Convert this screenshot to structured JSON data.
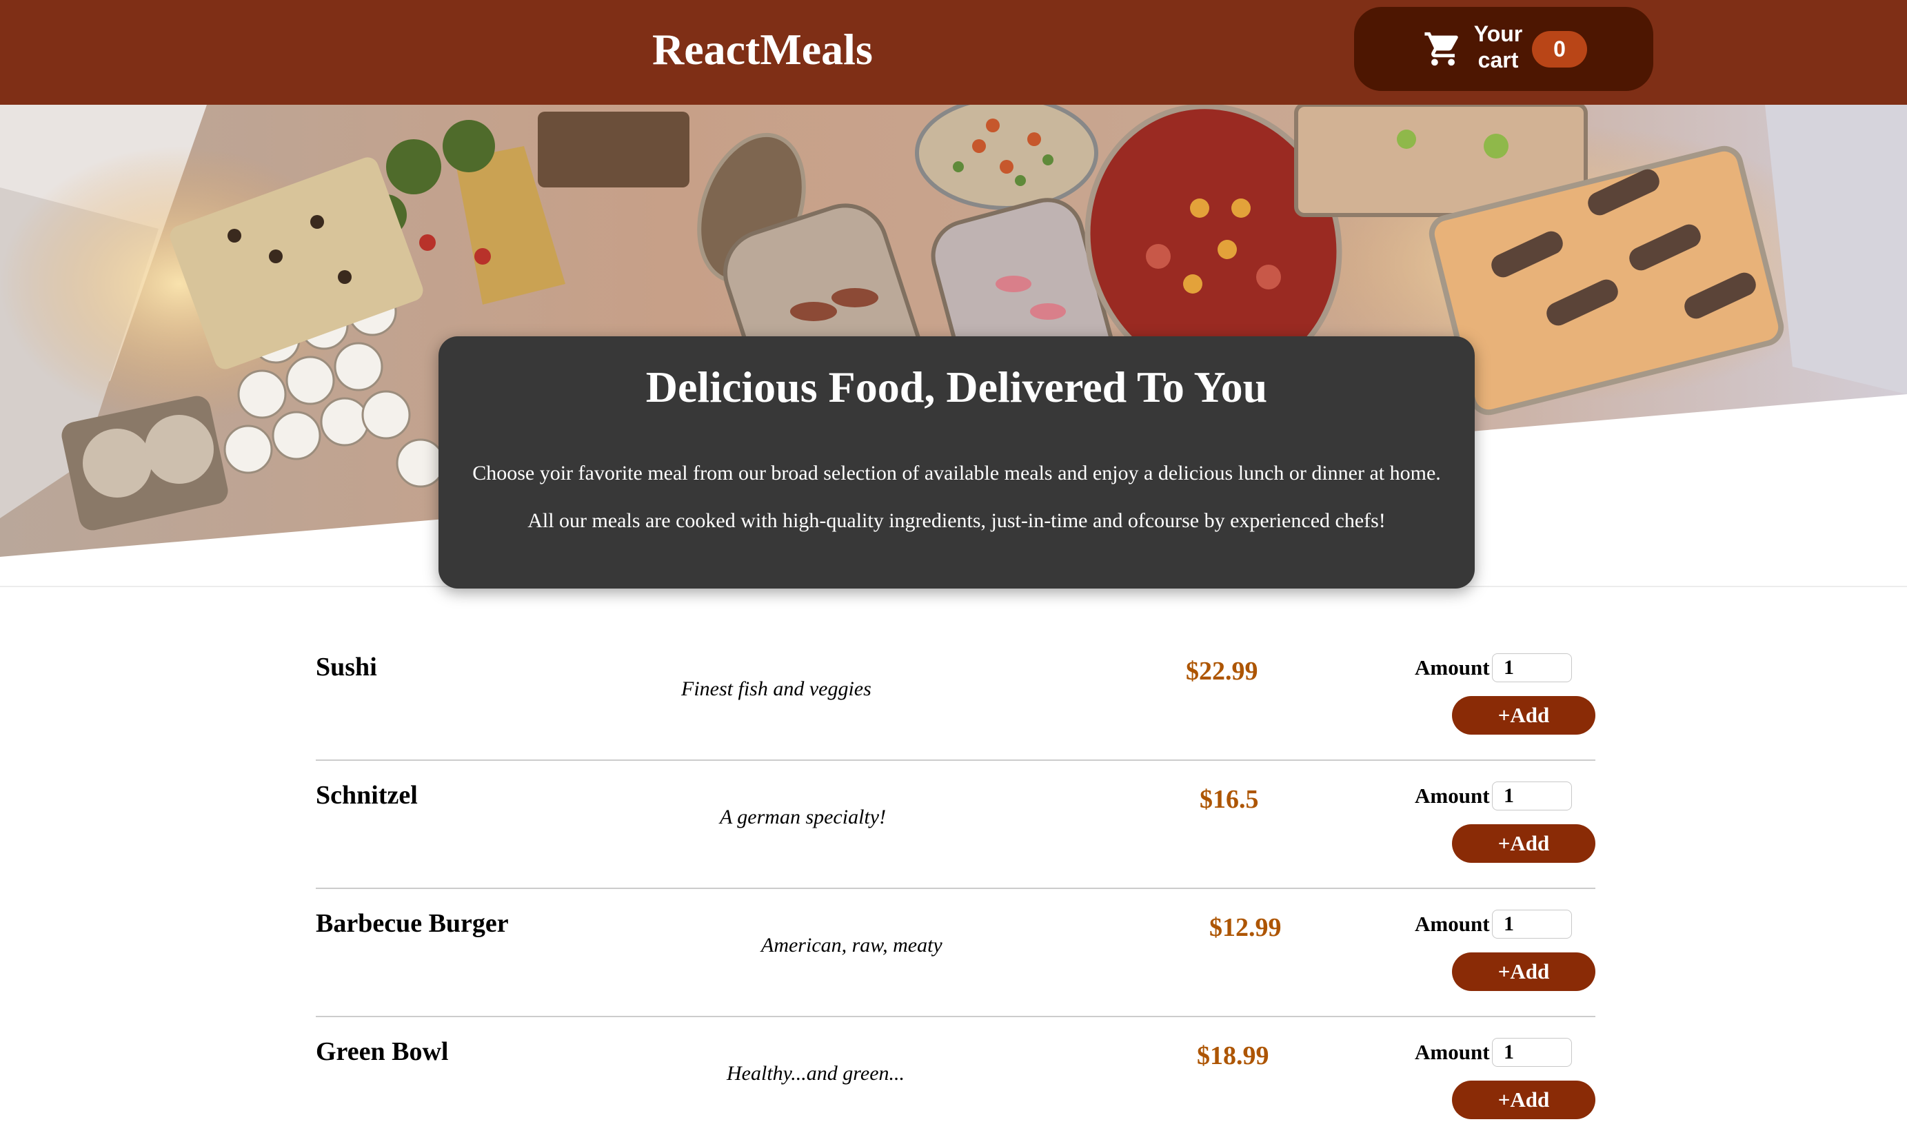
{
  "header": {
    "brand": "ReactMeals",
    "cart_label": "Your cart",
    "cart_count": "0",
    "cart_icon": "cart-icon"
  },
  "summary": {
    "title": "Delicious Food, Delivered To You",
    "paragraph1": "Choose yoir favorite meal from our broad selection of available meals and enjoy a delicious lunch or dinner at home.",
    "paragraph2": "All our meals are cooked with high-quality ingredients, just-in-time and ofcourse by experienced chefs!"
  },
  "meals": [
    {
      "name": "Sushi",
      "description": "Finest fish and veggies",
      "price": "$22.99",
      "amount_label": "Amount",
      "amount": "1",
      "add_label": "+Add"
    },
    {
      "name": "Schnitzel",
      "description": "A german specialty!",
      "price": "$16.5",
      "amount_label": "Amount",
      "amount": "1",
      "add_label": "+Add"
    },
    {
      "name": "Barbecue Burger",
      "description": "American, raw, meaty",
      "price": "$12.99",
      "amount_label": "Amount",
      "amount": "1",
      "add_label": "+Add"
    },
    {
      "name": "Green Bowl",
      "description": "Healthy...and green...",
      "price": "$18.99",
      "amount_label": "Amount",
      "amount": "1",
      "add_label": "+Add"
    }
  ],
  "colors": {
    "header": "#7f2f16",
    "cart_button": "#4d1601",
    "badge": "#b94517",
    "price": "#ad5502",
    "add_button": "#8a2b06",
    "summary_bg": "#383838"
  }
}
